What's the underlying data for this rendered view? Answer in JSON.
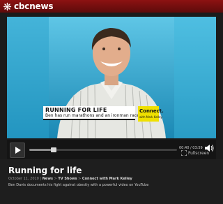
{
  "brand": {
    "wordmark": "cbcnews"
  },
  "video": {
    "lower_third_title": "RUNNING FOR LIFE",
    "lower_third_sub": "Ben has run marathons and an ironman race",
    "badge_title": "Connect.",
    "badge_sub": "with Mark Kelley"
  },
  "controls": {
    "timecode": "00:40 / 03:59",
    "progress": 0.167,
    "fullscreen_label": "Fullscreen"
  },
  "info": {
    "title": "Running for life",
    "date": "October 11, 2010",
    "breadcrumb": [
      "News",
      "TV Shows",
      "Connect with Mark Kelley"
    ],
    "separator": ">",
    "pipe": "|",
    "description": "Ben Davis documents his fight against obesity with a powerful video on YouTube"
  }
}
